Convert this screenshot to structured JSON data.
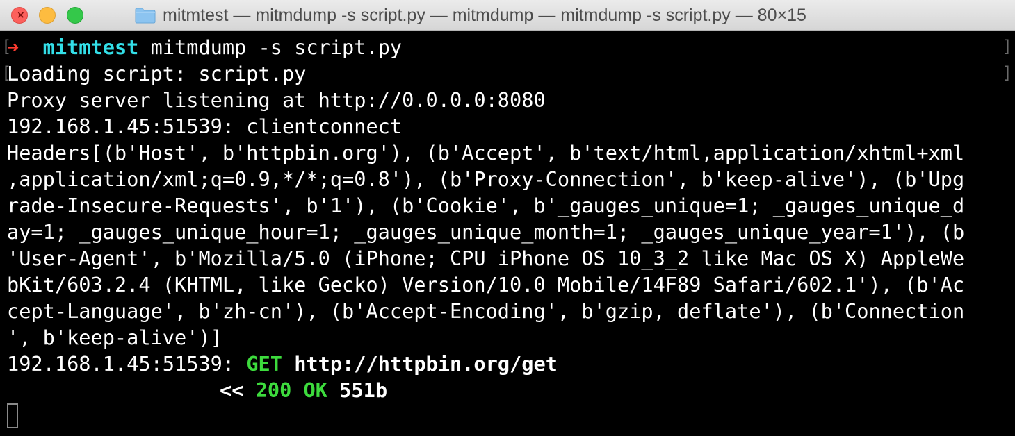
{
  "window": {
    "title": "mitmtest — mitmdump -s script.py — mitmdump — mitmdump -s script.py — 80×15"
  },
  "colors": {
    "prompt_arrow": "#ff3b2f",
    "prompt_dir": "#33dfe8",
    "status_green": "#3ddb3d",
    "text": "#ffffff",
    "background": "#000000"
  },
  "terminal": {
    "prompt": {
      "arrow": "➜",
      "directory": "mitmtest",
      "command": "mitmdump -s script.py"
    },
    "loading": "Loading script: script.py",
    "proxy": "Proxy server listening at http://0.0.0.0:8080",
    "clientconnect": "192.168.1.45:51539: clientconnect",
    "headers_lines": [
      "Headers[(b'Host', b'httpbin.org'), (b'Accept', b'text/html,application/xhtml+xml",
      ",application/xml;q=0.9,*/*;q=0.8'), (b'Proxy-Connection', b'keep-alive'), (b'Upg",
      "rade-Insecure-Requests', b'1'), (b'Cookie', b'_gauges_unique=1; _gauges_unique_d",
      "ay=1; _gauges_unique_hour=1; _gauges_unique_month=1; _gauges_unique_year=1'), (b",
      "'User-Agent', b'Mozilla/5.0 (iPhone; CPU iPhone OS 10_3_2 like Mac OS X) AppleWe",
      "bKit/603.2.4 (KHTML, like Gecko) Version/10.0 Mobile/14F89 Safari/602.1'), (b'Ac",
      "cept-Language', b'zh-cn'), (b'Accept-Encoding', b'gzip, deflate'), (b'Connection",
      "', b'keep-alive')]"
    ],
    "request": {
      "client": "192.168.1.45:51539: ",
      "method": "GET",
      "url": "http://httpbin.org/get"
    },
    "response": {
      "marker": "<<",
      "status": "200 OK",
      "size": "551b"
    }
  }
}
